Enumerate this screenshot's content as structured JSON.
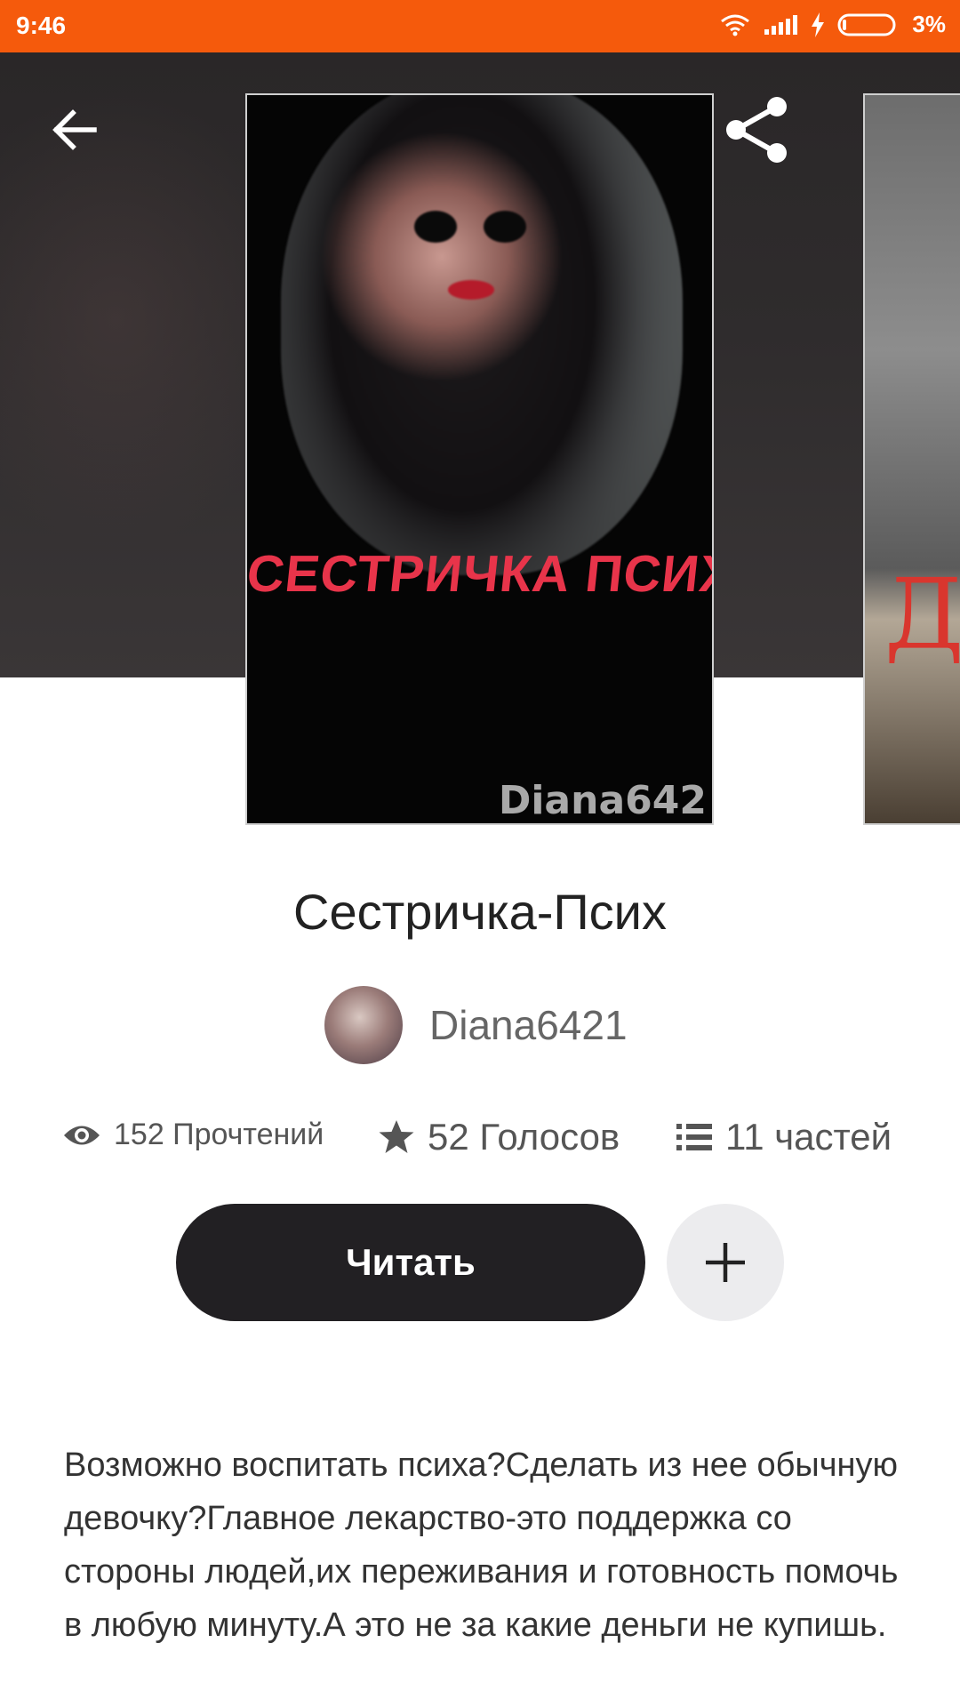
{
  "status_bar": {
    "time": "9:46",
    "battery": "3%"
  },
  "colors": {
    "accent": "#f55a0c",
    "dark_button": "#222023",
    "add_button_bg": "#ececee"
  },
  "icons": {
    "back": "arrow-left-icon",
    "share": "share-icon",
    "more": "more-vertical-icon",
    "reads": "eye-icon",
    "votes": "star-icon",
    "parts": "list-icon",
    "add": "plus-icon"
  },
  "cover": {
    "title_text": "СЕСТРИЧКА ПСИХ",
    "author_text": "Diana642"
  },
  "book": {
    "title": "Сестричка-Псих",
    "author": "Diana6421"
  },
  "stats": {
    "reads": "152 Прочтений",
    "votes": "52 Голосов",
    "parts": "11 частей"
  },
  "actions": {
    "read_label": "Читать"
  },
  "description": "Возможно воспитать психа?Сделать из нее обычную девочку?Главное лекарство-это поддержка со стороны людей,их переживания и готовность помочь в любую минуту.А это не за какие деньги не купишь."
}
